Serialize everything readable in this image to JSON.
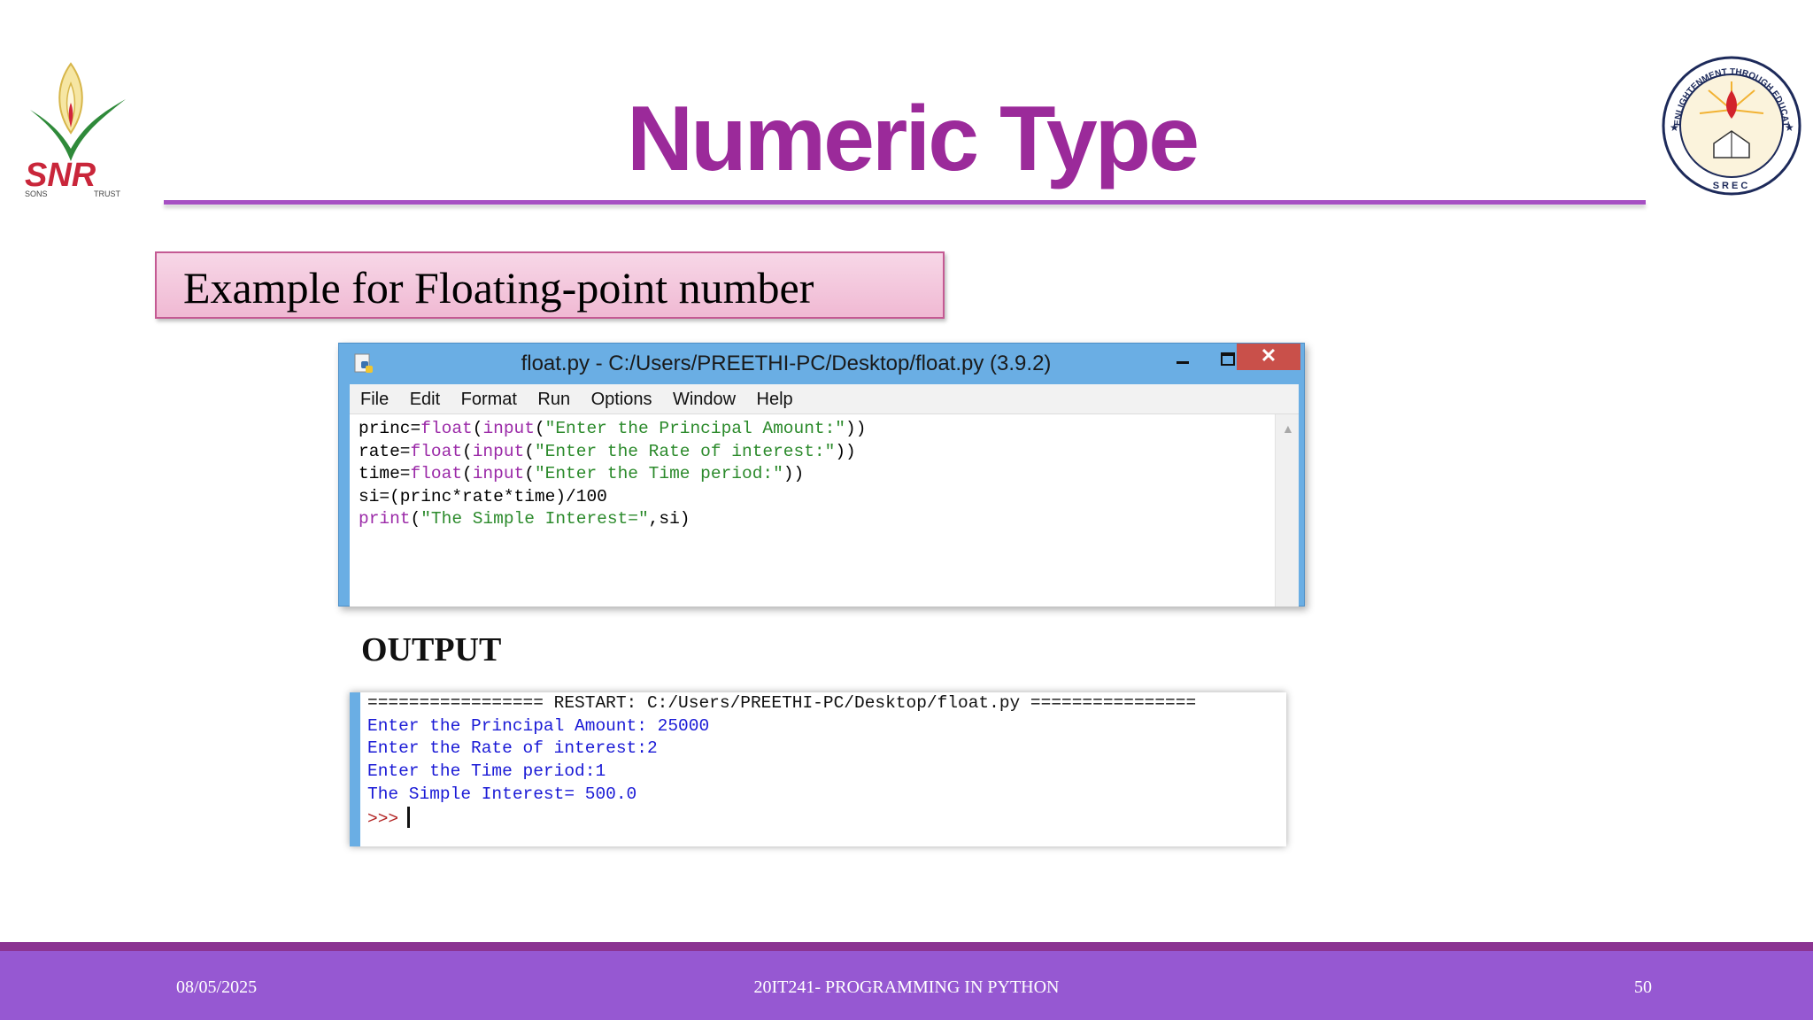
{
  "slide": {
    "title": "Numeric Type",
    "subtitle": "Example for Floating-point number",
    "output_heading": "OUTPUT"
  },
  "logos": {
    "left_logo_text": "SNR",
    "left_logo_small_left": "SONS",
    "left_logo_small_right": "TRUST",
    "right_seal_top_text": "ENLIGHTENMENT THROUGH EDUCATION",
    "right_seal_bottom_text": "SREC"
  },
  "editor": {
    "title": "float.py - C:/Users/PREETHI-PC/Desktop/float.py (3.9.2)",
    "close_glyph": "✕",
    "menu": [
      "File",
      "Edit",
      "Format",
      "Run",
      "Options",
      "Window",
      "Help"
    ],
    "code_lines": [
      "princ=float(input(\"Enter the Principal Amount:\"))",
      "rate=float(input(\"Enter the Rate of interest:\"))",
      "time=float(input(\"Enter the Time period:\"))",
      "si=(princ*rate*time)/100",
      "print(\"The Simple Interest=\",si)"
    ]
  },
  "shell": {
    "lines": [
      "================= RESTART: C:/Users/PREETHI-PC/Desktop/float.py ================",
      "Enter the Principal Amount: 25000",
      "Enter the Rate of interest:2",
      "Enter the Time period:1",
      "The Simple Interest= 500.0"
    ],
    "prompt": ">>>"
  },
  "footer": {
    "date": "08/05/2025",
    "course": "20IT241- PROGRAMMING IN PYTHON",
    "page": "50"
  },
  "colors": {
    "title": "#9b2a9a",
    "rule": "#a64fc3",
    "footer": "#9658d2",
    "window_frame": "#6aaee4",
    "close_button": "#c9504a",
    "keyword": "#9b2aa8",
    "string": "#2b8a2b",
    "shell_output": "#1a1ad6"
  },
  "icons": {
    "left_logo": "snr-lotus-logo",
    "right_logo": "srec-seal-logo",
    "window_app_icon": "python-idle-icon"
  }
}
